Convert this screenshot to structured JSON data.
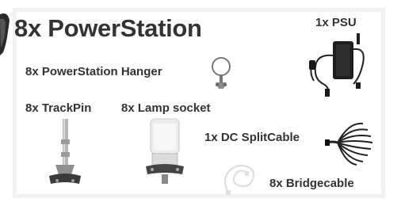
{
  "title": "8x PowerStation",
  "items": {
    "hanger": "8x PowerStation Hanger",
    "psu": "1x PSU",
    "trackpin": "8x TrackPin",
    "lamp_socket": "8x Lamp socket",
    "dc_splitcable": "1x DC SplitCable",
    "bridgecable": "8x Bridgecable"
  },
  "icons": [
    "powerstation-icon",
    "hanger-icon",
    "psu-icon",
    "trackpin-icon",
    "lamp-socket-icon",
    "dc-splitcable-icon",
    "bridgecable-icon"
  ],
  "colors": {
    "text": "#333333",
    "panel_border": "#f1f1f1"
  }
}
